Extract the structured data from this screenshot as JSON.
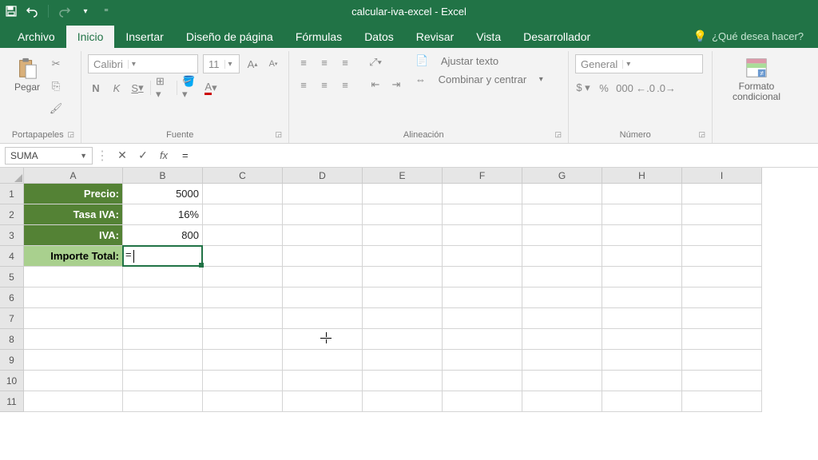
{
  "title": "calcular-iva-excel - Excel",
  "tabs": {
    "archivo": "Archivo",
    "inicio": "Inicio",
    "insertar": "Insertar",
    "diseno": "Diseño de página",
    "formulas": "Fórmulas",
    "datos": "Datos",
    "revisar": "Revisar",
    "vista": "Vista",
    "desarrollador": "Desarrollador"
  },
  "tell_me": "¿Qué desea hacer?",
  "ribbon": {
    "clipboard": {
      "paste": "Pegar",
      "label": "Portapapeles"
    },
    "font": {
      "name": "Calibri",
      "size": "11",
      "bold": "N",
      "italic": "K",
      "underline": "S",
      "label": "Fuente"
    },
    "alignment": {
      "wrap": "Ajustar texto",
      "merge": "Combinar y centrar",
      "label": "Alineación"
    },
    "number": {
      "format": "General",
      "label": "Número"
    },
    "styles": {
      "cond": "Formato condicional",
      "label": ""
    }
  },
  "formula_bar": {
    "namebox": "SUMA",
    "formula": "="
  },
  "columns": [
    "A",
    "B",
    "C",
    "D",
    "E",
    "F",
    "G",
    "H",
    "I"
  ],
  "rows": [
    "1",
    "2",
    "3",
    "4",
    "5",
    "6",
    "7",
    "8",
    "9",
    "10",
    "11"
  ],
  "cells": {
    "A1": "Precio:",
    "B1": "5000",
    "A2": "Tasa IVA:",
    "B2": "16%",
    "A3": "IVA:",
    "B3": "800",
    "A4": "Importe Total:",
    "B4": "="
  },
  "active_cell": "B4"
}
